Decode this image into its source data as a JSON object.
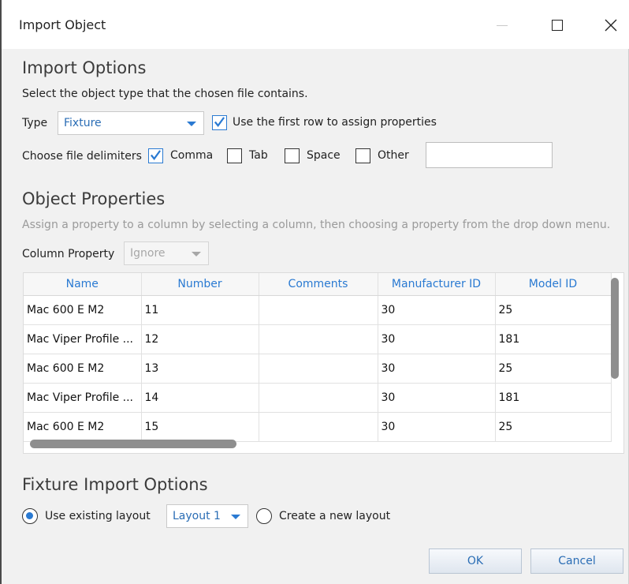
{
  "window": {
    "title": "Import Object"
  },
  "import_options": {
    "heading": "Import Options",
    "hint": "Select the object type that the chosen file contains.",
    "type_label": "Type",
    "type_value": "Fixture",
    "first_row_label": "Use the first row to assign properties",
    "first_row_checked": true,
    "delimiters_label": "Choose file delimiters",
    "delimiters": [
      {
        "label": "Comma",
        "checked": true
      },
      {
        "label": "Tab",
        "checked": false
      },
      {
        "label": "Space",
        "checked": false
      },
      {
        "label": "Other",
        "checked": false
      }
    ],
    "other_value": ""
  },
  "object_properties": {
    "heading": "Object Properties",
    "hint": "Assign a property to a column by selecting a column, then choosing a property from the drop down menu.",
    "column_property_label": "Column Property",
    "column_property_value": "Ignore",
    "columns": [
      "Name",
      "Number",
      "Comments",
      "Manufacturer ID",
      "Model ID"
    ],
    "rows": [
      [
        "Mac 600 E M2",
        "11",
        "",
        "30",
        "25"
      ],
      [
        "Mac Viper Profile ...",
        "12",
        "",
        "30",
        "181"
      ],
      [
        "Mac 600 E M2",
        "13",
        "",
        "30",
        "25"
      ],
      [
        "Mac Viper Profile ...",
        "14",
        "",
        "30",
        "181"
      ],
      [
        "Mac 600 E M2",
        "15",
        "",
        "30",
        "25"
      ]
    ]
  },
  "fixture_import": {
    "heading": "Fixture Import Options",
    "use_existing_label": "Use existing layout",
    "layout_value": "Layout 1",
    "create_new_label": "Create a new layout",
    "selected": "use_existing"
  },
  "footer": {
    "ok_label": "OK",
    "cancel_label": "Cancel"
  },
  "colors": {
    "accent": "#2a7ad2",
    "link_text": "#2a6db5"
  }
}
